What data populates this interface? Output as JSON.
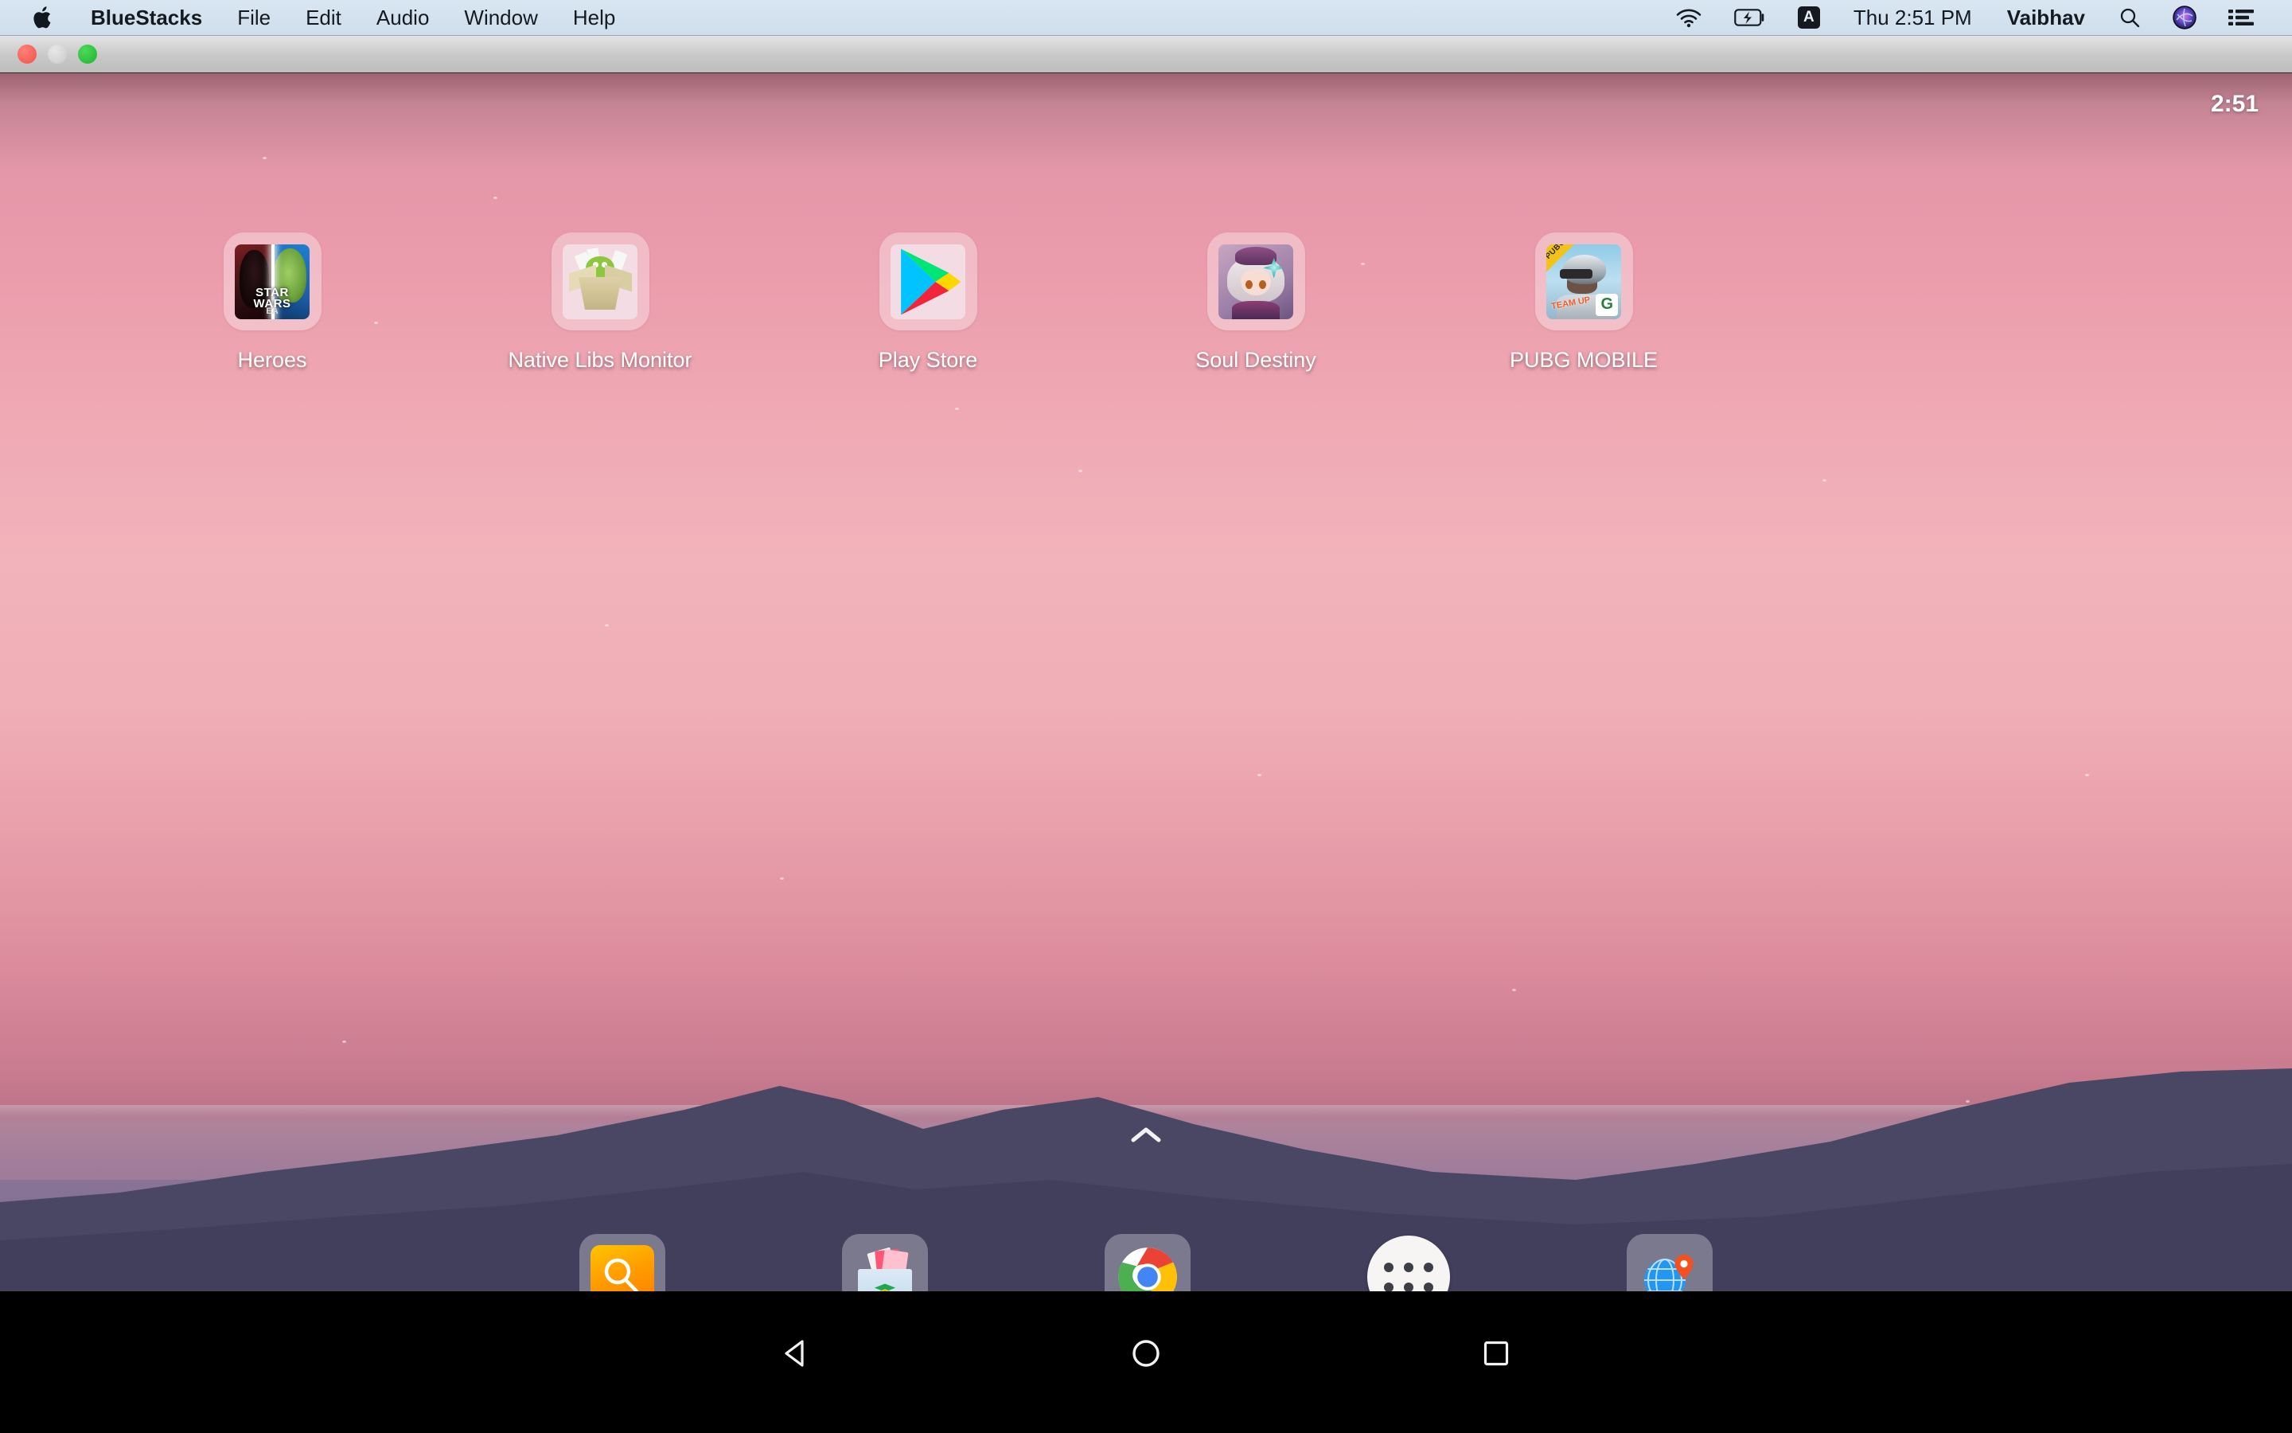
{
  "menubar": {
    "apple_icon": "apple-logo",
    "items": [
      {
        "label": "BlueStacks",
        "bold": true
      },
      {
        "label": "File",
        "bold": false
      },
      {
        "label": "Edit",
        "bold": false
      },
      {
        "label": "Audio",
        "bold": false
      },
      {
        "label": "Window",
        "bold": false
      },
      {
        "label": "Help",
        "bold": false
      }
    ],
    "status": {
      "wifi_icon": "wifi-icon",
      "battery_icon": "battery-charging-icon",
      "input_source": "A",
      "datetime": "Thu 2:51 PM",
      "user": "Vaibhav",
      "search_icon": "spotlight-search-icon",
      "siri_icon": "siri-icon",
      "control_center_icon": "control-center-icon"
    }
  },
  "window": {
    "close_label": "close",
    "minimize_label": "minimize",
    "zoom_label": "zoom"
  },
  "android": {
    "status_clock": "2:51",
    "pull_up_icon": "chevron-up-icon",
    "apps": [
      {
        "label": "Heroes",
        "icon": "star-wars-heroes-icon"
      },
      {
        "label": "Native Libs Monitor",
        "icon": "native-libs-monitor-icon"
      },
      {
        "label": "Play Store",
        "icon": "google-play-store-icon"
      },
      {
        "label": "Soul Destiny",
        "icon": "soul-destiny-icon"
      },
      {
        "label": "PUBG MOBILE",
        "icon": "pubg-mobile-icon"
      }
    ],
    "dock": [
      {
        "name": "search",
        "icon": "search-icon"
      },
      {
        "name": "media-manager",
        "icon": "media-manager-icon"
      },
      {
        "name": "chrome",
        "icon": "chrome-icon"
      },
      {
        "name": "app-drawer",
        "icon": "app-drawer-icon"
      },
      {
        "name": "browser-globe",
        "icon": "globe-pin-icon"
      }
    ],
    "navbar": [
      {
        "name": "back",
        "icon": "back-triangle-icon"
      },
      {
        "name": "home",
        "icon": "home-circle-icon"
      },
      {
        "name": "recents",
        "icon": "recents-square-icon"
      }
    ]
  },
  "icon_art": {
    "heroes_title_line1": "STAR",
    "heroes_title_line2": "WARS",
    "heroes_publisher": "EA",
    "pubg_ribbon": "PUBG",
    "pubg_team": "TEAM UP",
    "pubg_tencent": "G"
  },
  "colors": {
    "menubar_bg": "#d6e3ef",
    "titlebar_bg": "#c8c8c8",
    "traffic_close": "#f0534a",
    "traffic_min": "#d0d0d0",
    "traffic_zoom": "#1db52c",
    "navbar_bg": "#000000",
    "wallpaper_top": "#e497a8",
    "wallpaper_mid": "#f2b3bb",
    "wallpaper_low": "#7c6e94",
    "mountain": "#474563"
  }
}
